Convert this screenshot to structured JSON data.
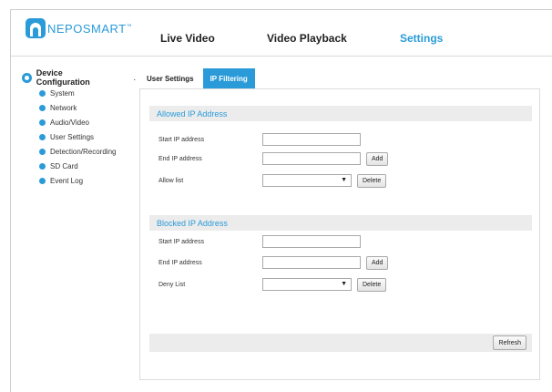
{
  "brand": {
    "name": "NEPOSMART",
    "mark": "™"
  },
  "topnav": {
    "live_video": "Live Video",
    "video_playback": "Video Playback",
    "settings": "Settings"
  },
  "sidebar": {
    "heading": "Device Configuration",
    "heading_tail": ".",
    "items": [
      {
        "label": "System"
      },
      {
        "label": "Network"
      },
      {
        "label": "Audio/Video"
      },
      {
        "label": "User Settings"
      },
      {
        "label": "Detection/Recording"
      },
      {
        "label": "SD Card"
      },
      {
        "label": "Event Log"
      }
    ]
  },
  "tabs": {
    "user_settings": "User Settings",
    "ip_filtering": "IP Filtering",
    "active": "IP Filtering"
  },
  "allowed": {
    "title": "Allowed IP Address",
    "start_label": "Start IP address",
    "start_value": "",
    "end_label": "End IP address",
    "end_value": "",
    "add_label": "Add",
    "list_label": "Allow list",
    "list_selected": "",
    "delete_label": "Delete"
  },
  "blocked": {
    "title": "Blocked IP Address",
    "start_label": "Start IP address",
    "start_value": "",
    "end_label": "End IP address",
    "end_value": "",
    "add_label": "Add",
    "list_label": "Deny List",
    "list_selected": "",
    "delete_label": "Delete"
  },
  "footer": {
    "refresh_label": "Refresh"
  },
  "icons": {
    "caret": "▼",
    "logo": "camera-logo-icon",
    "settings": "gear-icon",
    "bullet": "bullet-icon"
  },
  "colors": {
    "accent": "#2a9bd8",
    "section_bg": "#ececec"
  }
}
